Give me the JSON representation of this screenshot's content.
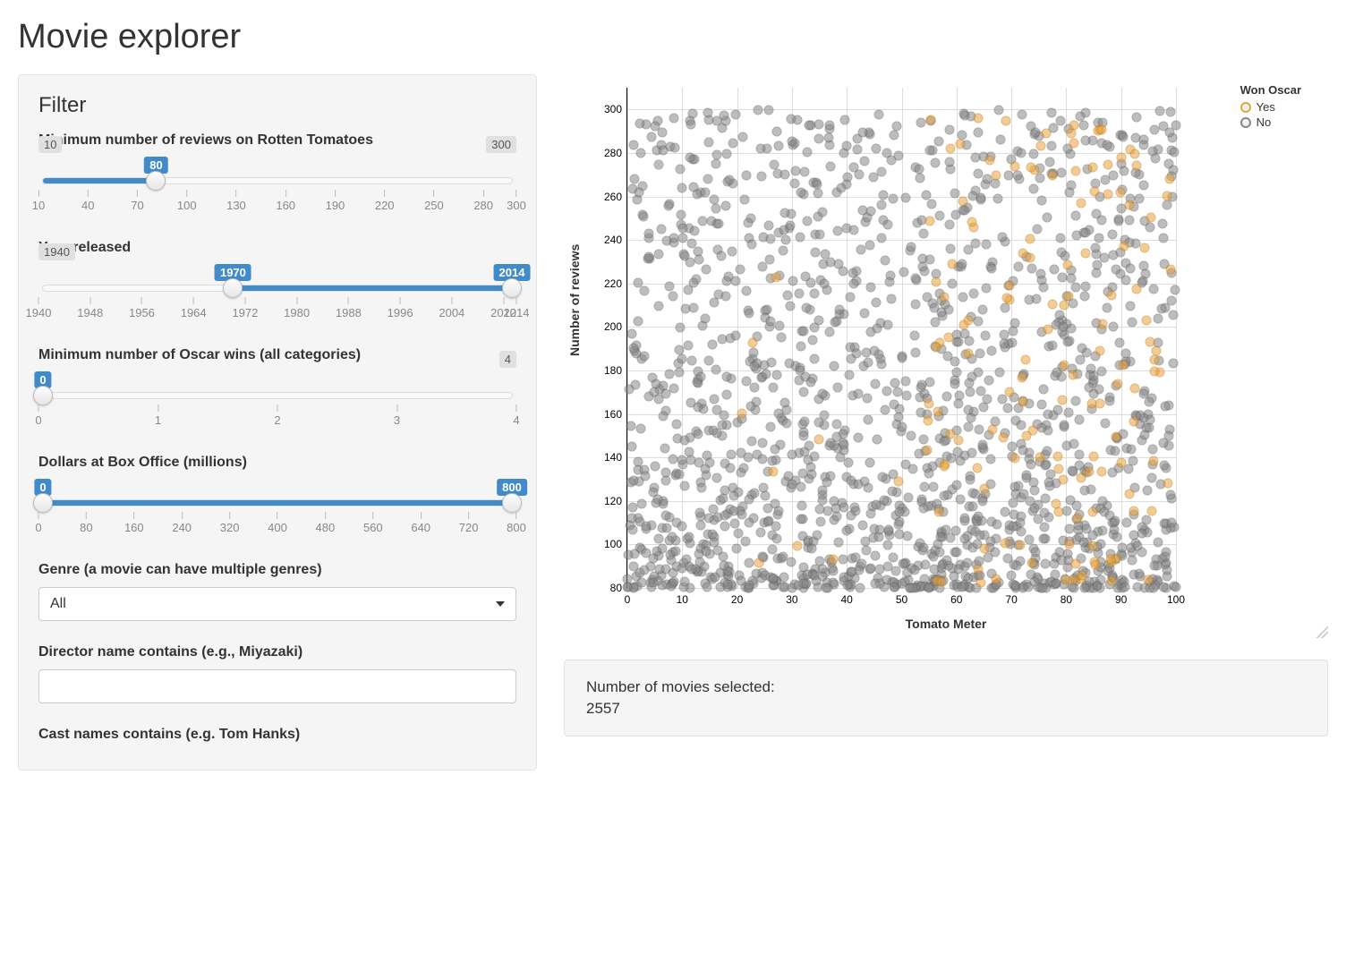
{
  "title": "Movie explorer",
  "filter": {
    "heading": "Filter",
    "reviews": {
      "label": "Minimum number of reviews on Rotten Tomatoes",
      "min": 10,
      "max": 300,
      "value": 80,
      "ticks": [
        10,
        40,
        70,
        100,
        130,
        160,
        190,
        220,
        250,
        280,
        300
      ]
    },
    "year": {
      "label": "Year released",
      "min": 1940,
      "max": 2014,
      "lo": 1970,
      "hi": 2014,
      "ticks": [
        1940,
        1948,
        1956,
        1964,
        1972,
        1980,
        1988,
        1996,
        2004,
        2012,
        2014
      ]
    },
    "oscars": {
      "label": "Minimum number of Oscar wins (all categories)",
      "min": 0,
      "max": 4,
      "value": 0,
      "ticks": [
        0,
        1,
        2,
        3,
        4
      ]
    },
    "boxoffice": {
      "label": "Dollars at Box Office (millions)",
      "min": 0,
      "max": 800,
      "lo": 0,
      "hi": 800,
      "ticks": [
        0,
        80,
        160,
        240,
        320,
        400,
        480,
        560,
        640,
        720,
        800
      ]
    },
    "genre": {
      "label": "Genre (a movie can have multiple genres)",
      "value": "All"
    },
    "director": {
      "label": "Director name contains (e.g., Miyazaki)",
      "value": ""
    },
    "cast": {
      "label": "Cast names contains (e.g. Tom Hanks)",
      "value": ""
    }
  },
  "summary": {
    "label": "Number of movies selected:",
    "count": "2557"
  },
  "chart_data": {
    "type": "scatter",
    "xlabel": "Tomato Meter",
    "ylabel": "Number of reviews",
    "xlim": [
      0,
      100
    ],
    "ylim": [
      80,
      310
    ],
    "xticks": [
      0,
      10,
      20,
      30,
      40,
      50,
      60,
      70,
      80,
      90,
      100
    ],
    "yticks": [
      80,
      100,
      120,
      140,
      160,
      180,
      200,
      220,
      240,
      260,
      280,
      300
    ],
    "legend": {
      "title": "Won Oscar",
      "items": [
        {
          "name": "Yes",
          "color": "#e8a33d"
        },
        {
          "name": "No",
          "color": "#888888"
        }
      ]
    },
    "n_points_approx": 2557,
    "series": [
      {
        "name": "No",
        "note": "dense cloud of ~2400 grey points; concentrated 80–180 reviews across full x range; thinning above 200",
        "sample_points": [
          [
            2,
            82
          ],
          [
            5,
            95
          ],
          [
            8,
            110
          ],
          [
            12,
            85
          ],
          [
            15,
            140
          ],
          [
            18,
            92
          ],
          [
            22,
            160
          ],
          [
            25,
            88
          ],
          [
            28,
            175
          ],
          [
            32,
            100
          ],
          [
            35,
            130
          ],
          [
            38,
            145
          ],
          [
            42,
            118
          ],
          [
            45,
            200
          ],
          [
            48,
            155
          ],
          [
            52,
            90
          ],
          [
            55,
            165
          ],
          [
            58,
            180
          ],
          [
            62,
            135
          ],
          [
            65,
            210
          ],
          [
            68,
            150
          ],
          [
            72,
            190
          ],
          [
            75,
            120
          ],
          [
            78,
            225
          ],
          [
            82,
            170
          ],
          [
            85,
            240
          ],
          [
            88,
            195
          ],
          [
            92,
            260
          ],
          [
            95,
            215
          ],
          [
            98,
            280
          ],
          [
            30,
            243
          ],
          [
            48,
            270
          ],
          [
            60,
            290
          ],
          [
            40,
            200
          ],
          [
            70,
            230
          ],
          [
            85,
            255
          ]
        ]
      },
      {
        "name": "Yes",
        "note": "~150 orange points; clustered right side x≥70, y 85–300",
        "sample_points": [
          [
            72,
            140
          ],
          [
            75,
            160
          ],
          [
            78,
            185
          ],
          [
            80,
            110
          ],
          [
            82,
            200
          ],
          [
            84,
            235
          ],
          [
            85,
            90
          ],
          [
            86,
            265
          ],
          [
            88,
            170
          ],
          [
            89,
            300
          ],
          [
            90,
            145
          ],
          [
            91,
            280
          ],
          [
            92,
            210
          ],
          [
            93,
            95
          ],
          [
            94,
            250
          ],
          [
            95,
            180
          ],
          [
            96,
            270
          ],
          [
            97,
            225
          ],
          [
            98,
            195
          ],
          [
            99,
            295
          ],
          [
            100,
            155
          ],
          [
            88,
            285
          ],
          [
            95,
            130
          ],
          [
            85,
            275
          ],
          [
            65,
            198
          ],
          [
            58,
            165
          ],
          [
            50,
            145
          ],
          [
            45,
            120
          ],
          [
            70,
            260
          ]
        ]
      }
    ]
  }
}
